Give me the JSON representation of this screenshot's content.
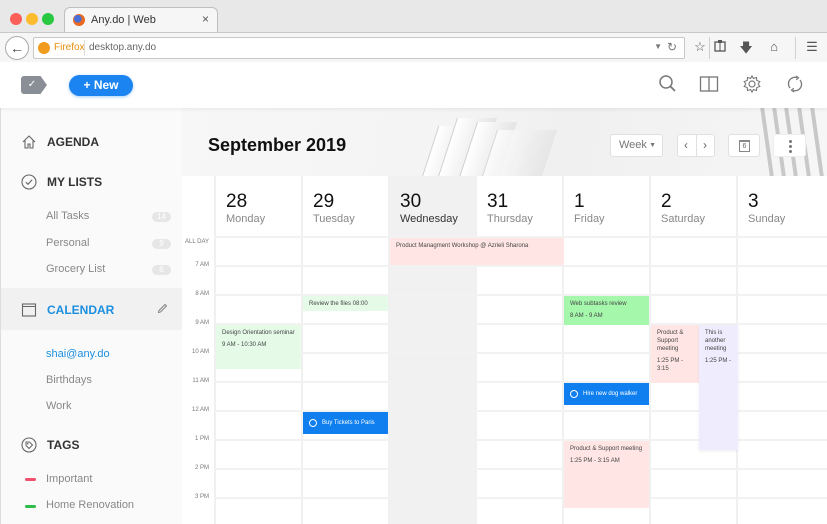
{
  "browser": {
    "tab_title": "Any.do | Web",
    "tab_close": "×",
    "identity_label": "Firefox",
    "url": "desktop.any.do",
    "buttons": [
      "back-icon",
      "bookmark-star-icon",
      "reading-list-icon",
      "download-icon",
      "home-icon",
      "menu-icon"
    ]
  },
  "header": {
    "logo_check": "✓",
    "new_button": "+ New",
    "icons": [
      "search-icon",
      "book-icon",
      "settings-icon",
      "sync-icon"
    ]
  },
  "sidebar": {
    "agenda": "AGENDA",
    "my_lists": "MY LISTS",
    "lists": [
      {
        "label": "All Tasks",
        "count": "14"
      },
      {
        "label": "Personal",
        "count": "9"
      },
      {
        "label": "Grocery List",
        "count": "6"
      }
    ],
    "calendar": "CALENDAR",
    "calendars": [
      "shai@any.do",
      "Birthdays",
      "Work"
    ],
    "tags_title": "TAGS",
    "tags": [
      {
        "label": "Important",
        "color": "#f0506e"
      },
      {
        "label": "Home Renovation",
        "color": "#2dbd4a"
      }
    ],
    "accent": "#1b8fe0"
  },
  "calendar": {
    "title": "September 2019",
    "view_select": "Week",
    "prev": "‹",
    "next": "›",
    "today_day": "6",
    "days": [
      {
        "num": "28",
        "name": "Monday"
      },
      {
        "num": "29",
        "name": "Tuesday"
      },
      {
        "num": "30",
        "name": "Wednesday",
        "today": true
      },
      {
        "num": "31",
        "name": "Thursday"
      },
      {
        "num": "1",
        "name": "Friday"
      },
      {
        "num": "2",
        "name": "Saturday"
      },
      {
        "num": "3",
        "name": "Sunday"
      }
    ],
    "allday_label": "ALL DAY",
    "hours": [
      "7 AM",
      "8 AM",
      "9 AM",
      "10 AM",
      "11 AM",
      "12 AM",
      "1 PM",
      "2 PM",
      "3 PM"
    ],
    "events": [
      {
        "title": "Product Managment Workshop @ Azrieli Sharona",
        "time": "",
        "day": 2,
        "span": 2,
        "allday": true,
        "color": "#ffe6e4"
      },
      {
        "title": "Review the files 08:00",
        "time": "",
        "day": 1,
        "start": 8.0,
        "end": 8.5,
        "color": "#e5fbe8"
      },
      {
        "title": "Design Orientation seminar",
        "time": "9 AM - 10:30 AM",
        "day": 0,
        "start": 9.0,
        "end": 10.5,
        "color": "#e5fbe8"
      },
      {
        "title": "Buy Tickets to Paris",
        "time": "",
        "day": 1,
        "start": 12.0,
        "end": 12.75,
        "color": "#0f7ff0",
        "task": true
      },
      {
        "title": "Web subtasks review",
        "time": "8 AM - 9 AM",
        "day": 4,
        "start": 8.0,
        "end": 9.0,
        "color": "#a4f7ab"
      },
      {
        "title": "Hire new dog walker",
        "time": "",
        "day": 4,
        "start": 11.0,
        "end": 11.75,
        "color": "#0f7ff0",
        "task": true
      },
      {
        "title": "Product & Support meeting",
        "time": "1:25 PM - 3:15 AM",
        "day": 4,
        "start": 13.0,
        "end": 15.3,
        "color": "#ffe6e4"
      },
      {
        "title": "Product & Support meeting",
        "time": "1:25 PM - 3:15",
        "day": 5,
        "start": 9.0,
        "end": 11.0,
        "color": "#ffe6e4",
        "narrow": true
      },
      {
        "title": "This is another meeting",
        "time": "1:25 PM -",
        "day": 5,
        "start": 9.0,
        "end": 13.3,
        "color": "#eeecfd",
        "overlay": true
      }
    ]
  }
}
